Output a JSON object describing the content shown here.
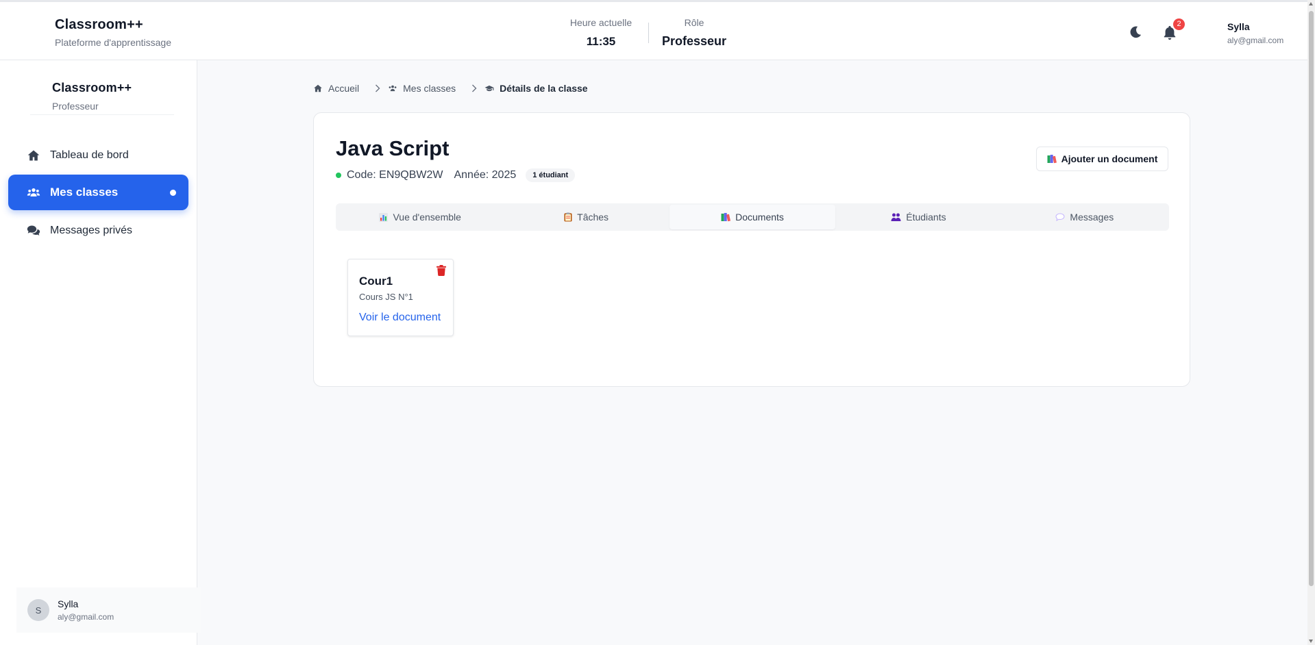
{
  "header": {
    "brand_title": "Classroom++",
    "brand_subtitle": "Plateforme d'apprentissage",
    "time_label": "Heure actuelle",
    "time_value": "11:35",
    "role_label": "Rôle",
    "role_value": "Professeur",
    "notification_count": "2",
    "user_name": "Sylla",
    "user_email": "aly@gmail.com"
  },
  "sidebar": {
    "brand_title": "Classroom++",
    "brand_subtitle": "Professeur",
    "items": [
      {
        "label": "Tableau de bord",
        "icon": "home-icon",
        "active": false
      },
      {
        "label": "Mes classes",
        "icon": "users-icon",
        "active": true
      },
      {
        "label": "Messages privés",
        "icon": "comments-icon",
        "active": false
      }
    ],
    "user": {
      "initial": "S",
      "name": "Sylla",
      "email": "aly@gmail.com"
    }
  },
  "breadcrumb": [
    {
      "label": "Accueil",
      "icon": "home-icon"
    },
    {
      "label": "Mes classes",
      "icon": "users-icon"
    },
    {
      "label": "Détails de la classe",
      "icon": "graduation-cap-icon"
    }
  ],
  "class": {
    "title": "Java Script",
    "code": "Code: EN9QBW2W",
    "year": "Année: 2025",
    "students_badge": "1 étudiant",
    "add_document_label": "Ajouter un document"
  },
  "tabs": [
    {
      "label": "Vue d'ensemble",
      "icon": "bar-chart-icon",
      "active": false
    },
    {
      "label": "Tâches",
      "icon": "clipboard-icon",
      "active": false
    },
    {
      "label": "Documents",
      "icon": "books-icon",
      "active": true
    },
    {
      "label": "Étudiants",
      "icon": "people-icon",
      "active": false
    },
    {
      "label": "Messages",
      "icon": "speech-bubble-icon",
      "active": false
    }
  ],
  "documents": [
    {
      "title": "Cour1",
      "description": "Cours JS N°1",
      "link_label": "Voir le document"
    }
  ],
  "colors": {
    "accent": "#2563eb",
    "status_dot": "#22c55e",
    "danger": "#dc2626",
    "badge": "#ef4444"
  }
}
